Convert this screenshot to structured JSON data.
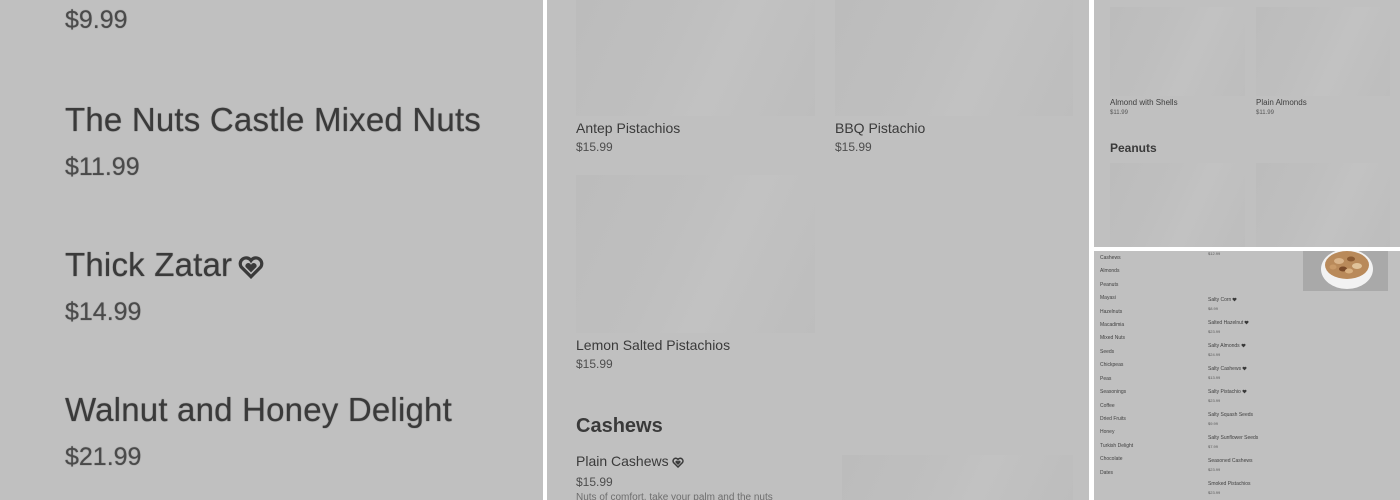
{
  "colors": {
    "background": "#c0c0c0",
    "divider": "#ffffff",
    "text": "#3a3a3a",
    "placeholder": "#bdbdbd"
  },
  "zoom_list": {
    "top_price": "$9.99",
    "items": [
      {
        "name": "The Nuts Castle Mixed Nuts",
        "price": "$11.99",
        "favorite": false
      },
      {
        "name": "Thick Zatar",
        "price": "$14.99",
        "favorite": true
      },
      {
        "name": "Walnut and Honey Delight",
        "price": "$21.99",
        "favorite": false
      }
    ]
  },
  "grid": {
    "products": [
      {
        "name": "Antep Pistachios",
        "price": "$15.99"
      },
      {
        "name": "BBQ Pistachio",
        "price": "$15.99"
      },
      {
        "name": "Lemon Salted Pistachios",
        "price": "$15.99"
      }
    ],
    "section_title": "Cashews",
    "section_item": {
      "name": "Plain Cashews",
      "price": "$15.99",
      "favorite": true,
      "description": "Nuts of comfort, take your palm and the nuts"
    }
  },
  "almonds_panel": {
    "products": [
      {
        "name": "Almond with Shells",
        "price": "$11.99"
      },
      {
        "name": "Plain Almonds",
        "price": "$11.99"
      }
    ],
    "next_section": "Peanuts"
  },
  "overview": {
    "categories": [
      "Cashews",
      "Almonds",
      "Peanuts",
      "Mayasi",
      "Hazelnuts",
      "Macadimia",
      "Mixed Nuts",
      "Seeds",
      "Chickpeas",
      "Peas",
      "Seasonings",
      "Coffee",
      "Dried Fruits",
      "Honey",
      "Turkish Delight",
      "Chocolate",
      "Dates"
    ],
    "top_price": "$12.99",
    "items": [
      {
        "name": "Salty Corn",
        "price": "$8.99",
        "favorite": true
      },
      {
        "name": "Salted Hazelnut",
        "price": "$23.99",
        "favorite": true
      },
      {
        "name": "Salty Almonds",
        "price": "$24.99",
        "favorite": true
      },
      {
        "name": "Salty Cashews",
        "price": "$13.99",
        "favorite": true
      },
      {
        "name": "Salty Pistachio",
        "price": "$23.99",
        "favorite": true
      },
      {
        "name": "Salty Squash Seeds",
        "price": "$9.99",
        "favorite": false
      },
      {
        "name": "Salty Sunflower Seeds",
        "price": "$7.99",
        "favorite": false
      },
      {
        "name": "Seasoned Cashews",
        "price": "$23.99",
        "favorite": false
      },
      {
        "name": "Smoked Pistachios",
        "price": "$23.99",
        "favorite": false
      }
    ],
    "image_icon": "mixed-nuts-bowl-image"
  }
}
